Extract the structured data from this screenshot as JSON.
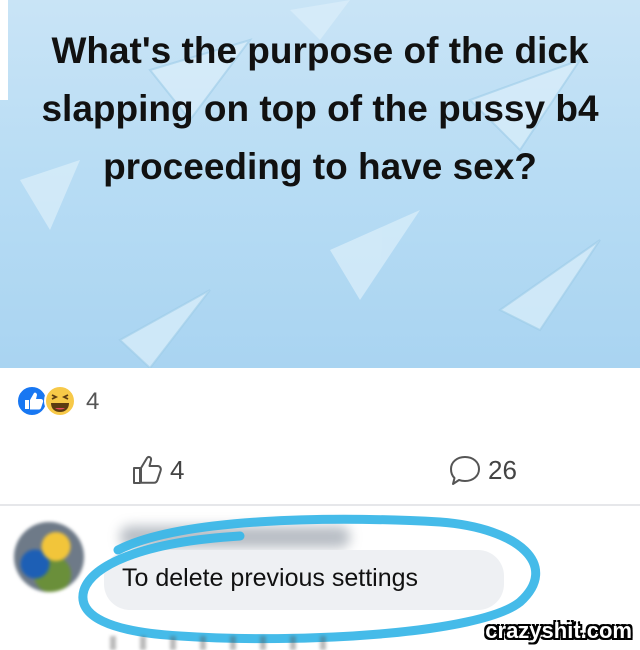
{
  "post": {
    "text": "What's the purpose of the dick slapping on top of the pussy b4 proceeding to have sex?",
    "background_color": "#b7dcf4"
  },
  "reactions": {
    "icons": [
      "like-icon",
      "haha-icon"
    ],
    "count": "4"
  },
  "actions": {
    "like_count": "4",
    "comment_count": "26",
    "like_icon": "thumbs-up-outline-icon",
    "comment_icon": "speech-bubble-icon"
  },
  "comment": {
    "text": "To delete previous settings",
    "highlight_color": "#3bb7e8"
  },
  "watermark": {
    "text": "crazyshit.com"
  }
}
